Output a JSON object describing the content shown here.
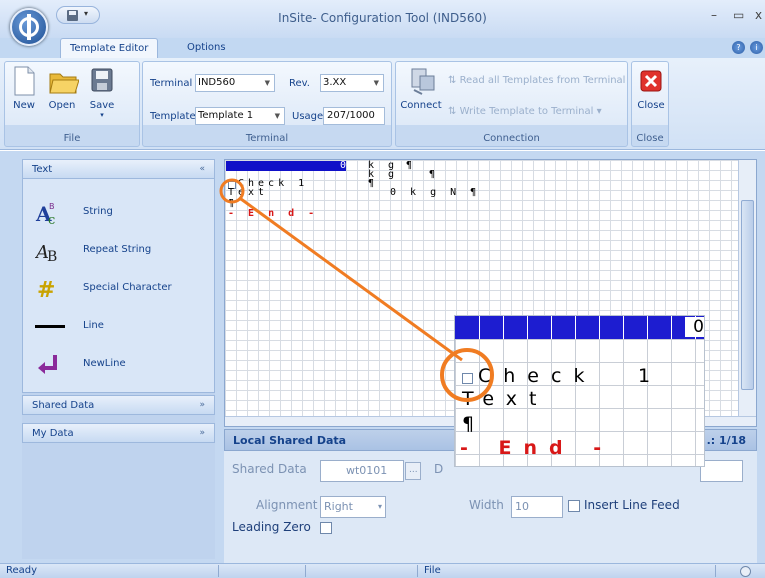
{
  "window": {
    "title": "InSite- Configuration Tool (IND560)",
    "minimize": "–",
    "maximize": "▭",
    "close": "x"
  },
  "tabs": [
    {
      "label": "Template Editor"
    },
    {
      "label": "Options"
    }
  ],
  "ribbon": {
    "file": {
      "new": "New",
      "open": "Open",
      "save": "Save",
      "group": "File"
    },
    "terminal": {
      "terminal_label": "Terminal",
      "terminal_value": "IND560",
      "rev_label": "Rev.",
      "rev_value": "3.XX",
      "template_label": "Template",
      "template_value": "Template 1",
      "usage_label": "Usage",
      "usage_value": "207/1000",
      "group": "Terminal"
    },
    "connection": {
      "connect": "Connect",
      "read_all": "Read all Templates from Terminal",
      "write": "Write Template to Terminal",
      "group": "Connection"
    },
    "close": {
      "close": "Close",
      "group": "Close"
    }
  },
  "leftpane": {
    "text_header": "Text",
    "tools": [
      "String",
      "Repeat String",
      "Special Character",
      "Line",
      "NewLine"
    ],
    "shared_header": "Shared Data",
    "mydata_header": "My Data"
  },
  "editor": {
    "row1_num": "0",
    "row1_kg": "k g",
    "row1_pil": "¶",
    "row2_kg": "k g",
    "row2_pil": "¶",
    "row3": "Check 1",
    "row3_pil": "¶",
    "row4": "Text",
    "row4_tail": "0 k g N ¶",
    "row5": "¶",
    "row6": "- E n d -"
  },
  "local_shared": {
    "title": "Local Shared Data",
    "page": ".: 1/18",
    "shared_label": "Shared Data",
    "shared_value": "wt0101",
    "browse": "...",
    "d_label": "D",
    "align_label": "Alignment",
    "align_value": "Right",
    "width_label": "Width",
    "width_value": "10",
    "insert_lf": "Insert Line Feed",
    "leading_zero": "Leading Zero"
  },
  "zoom": {
    "num": "0",
    "row_check": "Check",
    "row_num": "1",
    "row_text": "Text",
    "row_pil": "¶",
    "row_end": "- End -"
  },
  "status": {
    "ready": "Ready",
    "file": "File"
  },
  "colors": {
    "accent": "#f07c22",
    "cell_blue": "#1010c8",
    "end_red": "#d81818"
  }
}
